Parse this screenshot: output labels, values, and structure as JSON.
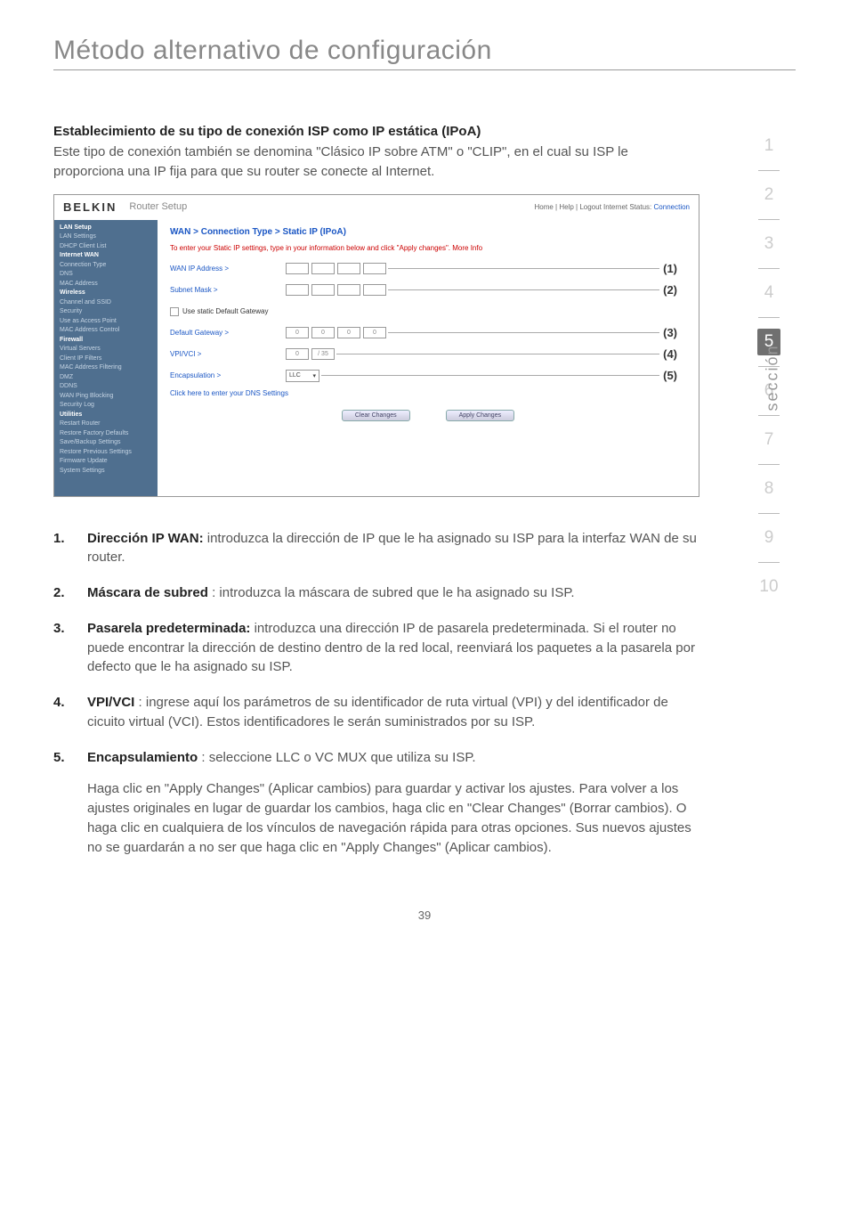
{
  "page": {
    "title": "Método alternativo de configuración",
    "number": "39"
  },
  "rotated_label": "sección",
  "section_nums": [
    "1",
    "2",
    "3",
    "4",
    "5",
    "6",
    "7",
    "8",
    "9",
    "10"
  ],
  "active_section_index": 4,
  "heading": "Establecimiento de su tipo de conexión ISP como IP estática (IPoA)",
  "intro": "Este tipo de conexión también se denomina \"Clásico IP sobre ATM\" o \"CLIP\", en el cual su ISP le proporciona una IP fija para que su router se conecte al Internet.",
  "screenshot": {
    "logo": "BELKIN",
    "subtitle": "Router Setup",
    "top_links": "Home | Help | Logout   Internet Status:",
    "top_status": "Connection",
    "breadcrumb": "WAN > Connection Type > Static IP (IPoA)",
    "note": "To enter your Static IP settings, type in your information below and click \"Apply changes\". More Info",
    "rows": [
      {
        "label": "WAN IP Address >",
        "fields": [
          "",
          "",
          "",
          ""
        ],
        "num": "(1)"
      },
      {
        "label": "Subnet Mask >",
        "fields": [
          "",
          "",
          "",
          ""
        ],
        "num": "(2)"
      },
      {
        "label_plain": "Use static Default Gateway",
        "checkbox": true
      },
      {
        "label": "Default Gateway >",
        "fields": [
          "0",
          "0",
          "0",
          "0"
        ],
        "num": "(3)"
      },
      {
        "label": "VPI/VCI >",
        "fields_two": [
          "0",
          "/ 35"
        ],
        "num": "(4)"
      },
      {
        "label": "Encapsulation >",
        "select": "LLC",
        "num": "(5)"
      }
    ],
    "dns_link": "Click here to enter your DNS Settings",
    "btn_clear": "Clear Changes",
    "btn_apply": "Apply Changes",
    "sidebar": [
      "LAN Setup",
      "LAN Settings",
      "DHCP Client List",
      "Internet WAN",
      "Connection Type",
      "DNS",
      "MAC Address",
      "Wireless",
      "Channel and SSID",
      "Security",
      "Use as Access Point",
      "MAC Address Control",
      "Firewall",
      "Virtual Servers",
      "Client IP Filters",
      "MAC Address Filtering",
      "DMZ",
      "DDNS",
      "WAN Ping Blocking",
      "Security Log",
      "Utilities",
      "Restart Router",
      "Restore Factory Defaults",
      "Save/Backup Settings",
      "Restore Previous Settings",
      "Firmware Update",
      "System Settings"
    ],
    "sidebar_headers": [
      0,
      3,
      7,
      12,
      20
    ]
  },
  "items": [
    {
      "n": "1.",
      "t": "Dirección IP WAN:",
      "b": " introduzca la dirección de IP que le ha asignado su ISP para la interfaz WAN de su router."
    },
    {
      "n": "2.",
      "t": "Máscara de subred",
      "b": "  : introduzca la máscara de subred que le ha asignado su ISP."
    },
    {
      "n": "3.",
      "t": "Pasarela predeterminada:",
      "b": "  introduzca una dirección IP de pasarela predeterminada. Si el router no puede encontrar la dirección de destino dentro de la red local, reenviará los paquetes a la pasarela por defecto que le ha asignado su ISP."
    },
    {
      "n": "4.",
      "t": "VPI/VCI",
      "b": " : ingrese aquí los parámetros de su identificador de ruta virtual (VPI) y del identificador de cicuito virtual (VCI). Estos identificadores le serán suministrados por su ISP."
    },
    {
      "n": "5.",
      "t": "Encapsulamiento",
      "b": " : seleccione LLC o VC MUX que utiliza su ISP."
    }
  ],
  "follow": "Haga clic en \"Apply Changes\" (Aplicar cambios) para guardar y activar los ajustes. Para volver a los ajustes originales en lugar de guardar los cambios, haga clic en \"Clear Changes\" (Borrar cambios). O haga clic en cualquiera de los vínculos de navegación rápida para otras opciones. Sus nuevos ajustes no se guardarán a no ser que haga clic en \"Apply Changes\" (Aplicar cambios)."
}
